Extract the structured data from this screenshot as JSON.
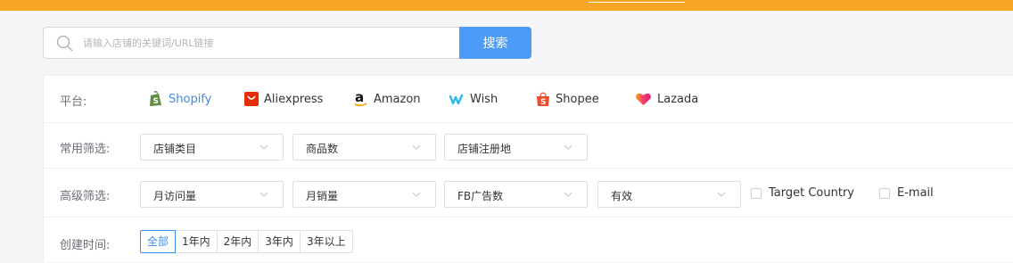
{
  "search": {
    "placeholder": "请输入店铺的关键词/URL链接",
    "button_label": "搜索"
  },
  "filters": {
    "platform_label": "平台:",
    "platforms": [
      {
        "name": "Shopify",
        "icon": "shopify-icon",
        "active": true
      },
      {
        "name": "Aliexpress",
        "icon": "aliexpress-icon",
        "active": false
      },
      {
        "name": "Amazon",
        "icon": "amazon-icon",
        "active": false
      },
      {
        "name": "Wish",
        "icon": "wish-icon",
        "active": false
      },
      {
        "name": "Shopee",
        "icon": "shopee-icon",
        "active": false
      },
      {
        "name": "Lazada",
        "icon": "lazada-icon",
        "active": false
      }
    ],
    "common_label": "常用筛选:",
    "common_selects": [
      "店铺类目",
      "商品数",
      "店铺注册地"
    ],
    "advanced_label": "高级筛选:",
    "advanced_selects": [
      "月访问量",
      "月销量",
      "FB广告数",
      "有效"
    ],
    "checkboxes": [
      {
        "label": "Target Country",
        "checked": false
      },
      {
        "label": "E-mail",
        "checked": false
      }
    ],
    "created_label": "创建时间:",
    "created_tabs": [
      {
        "label": "全部",
        "active": true
      },
      {
        "label": "1年内",
        "active": false
      },
      {
        "label": "2年内",
        "active": false
      },
      {
        "label": "3年内",
        "active": false
      },
      {
        "label": "3年以上",
        "active": false
      }
    ]
  },
  "colors": {
    "accent": "#4b9bf7",
    "active_text": "#3b8cef",
    "topbar": "#f7a623"
  }
}
